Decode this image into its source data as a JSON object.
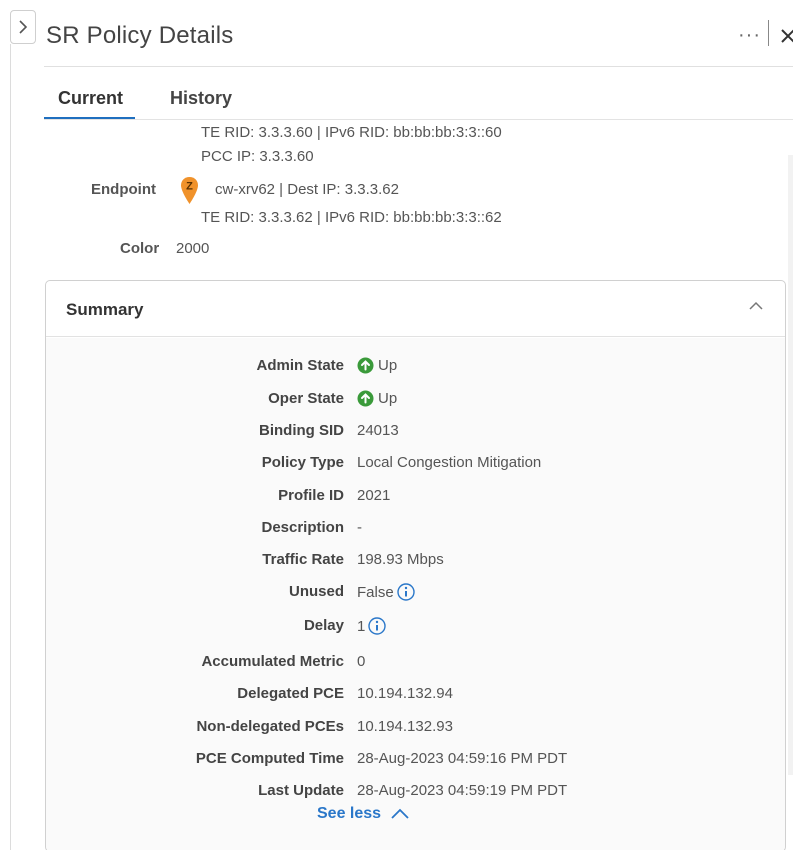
{
  "header": {
    "title": "SR Policy Details",
    "more_label": "···"
  },
  "tabs": [
    {
      "label": "Current",
      "active": true
    },
    {
      "label": "History",
      "active": false
    }
  ],
  "headend": {
    "line1": "TE RID: 3.3.3.60 | IPv6 RID: bb:bb:bb:3:3::60",
    "line2": "PCC IP: 3.3.3.60"
  },
  "endpoint": {
    "label": "Endpoint",
    "icon_letter": "Z",
    "line1": "cw-xrv62 | Dest IP: 3.3.3.62",
    "line2": "TE RID: 3.3.3.62 | IPv6 RID: bb:bb:bb:3:3::62"
  },
  "color": {
    "label": "Color",
    "value": "2000"
  },
  "summary": {
    "title": "Summary",
    "rows": [
      {
        "label": "Admin State",
        "value": "Up",
        "icon": "up-status-icon"
      },
      {
        "label": "Oper State",
        "value": "Up",
        "icon": "up-status-icon"
      },
      {
        "label": "Binding SID",
        "value": "24013"
      },
      {
        "label": "Policy Type",
        "value": "Local Congestion Mitigation"
      },
      {
        "label": "Profile ID",
        "value": "2021"
      },
      {
        "label": "Description",
        "value": "-"
      },
      {
        "label": "Traffic Rate",
        "value": "198.93 Mbps"
      },
      {
        "label": "Unused",
        "value": "False",
        "icon": "info-icon"
      },
      {
        "label": "Delay",
        "value": "1",
        "icon": "info-icon"
      },
      {
        "label": "Accumulated Metric",
        "value": "0"
      },
      {
        "label": "Delegated PCE",
        "value": "10.194.132.94"
      },
      {
        "label": "Non-delegated PCEs",
        "value": "10.194.132.93"
      },
      {
        "label": "PCE Computed Time",
        "value": "28-Aug-2023 04:59:16 PM PDT"
      },
      {
        "label": "Last Update",
        "value": "28-Aug-2023 04:59:19 PM PDT"
      }
    ],
    "see_less_label": "See less"
  },
  "colors": {
    "accent": "#1f6fbf",
    "status_up": "#3a9a3a",
    "endpoint_marker": "#f0922b",
    "link": "#2a77c9"
  }
}
